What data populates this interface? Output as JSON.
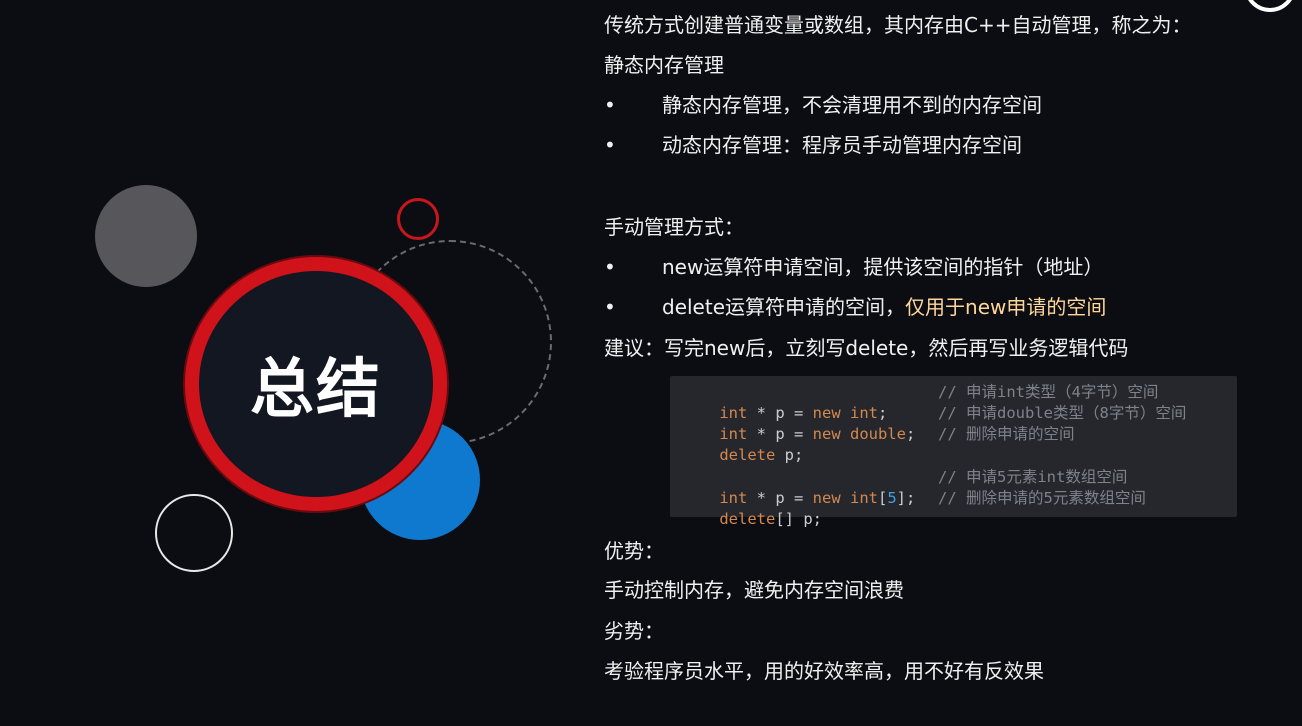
{
  "title": "总结",
  "intro": {
    "line1": "传统方式创建普通变量或数组，其内存由C++自动管理，称之为：",
    "line2": "静态内存管理"
  },
  "memory_types": [
    "静态内存管理，不会清理用不到的内存空间",
    "动态内存管理：程序员手动管理内存空间"
  ],
  "manual": {
    "heading": "手动管理方式：",
    "bullet1": "new运算符申请空间，提供该空间的指针（地址）",
    "bullet2_normal": "delete运算符申请的空间，",
    "bullet2_highlight": "仅用于new申请的空间"
  },
  "advice": "建议：写完new后，立刻写delete，然后再写业务逻辑代码",
  "code": {
    "line1_kw1": "int",
    "line1_rest1": " * p = ",
    "line1_kw2": "new int",
    "line1_rest2": ";",
    "line1_comment": "// 申请int类型（4字节）空间",
    "line2_kw1": "int",
    "line2_rest1": " * p = ",
    "line2_kw2": "new double",
    "line2_rest2": ";",
    "line2_comment": "// 申请double类型（8字节）空间",
    "line3_kw1": "delete",
    "line3_rest1": " p;",
    "line3_comment": "// 删除申请的空间",
    "line4_kw1": "int",
    "line4_rest1": " * p = ",
    "line4_kw2": "new int",
    "line4_rest2": "[",
    "line4_num": "5",
    "line4_rest3": "];",
    "line4_comment": "// 申请5元素int数组空间",
    "line5_kw1": "delete",
    "line5_rest1": "[] p;",
    "line5_comment": "// 删除申请的5元素数组空间"
  },
  "pros": {
    "heading": "优势：",
    "text": "手动控制内存，避免内存空间浪费"
  },
  "cons": {
    "heading": "劣势：",
    "text": "考验程序员水平，用的好效率高，用不好有反效果"
  },
  "bullet_symbol": "•",
  "colors": {
    "background": "#0c0d12",
    "ring_red": "#d0131b",
    "blue_circle": "#0f79cf",
    "gray_circle": "#57575b",
    "highlight_text": "#ffd79a",
    "code_keyword": "#d4884e",
    "code_number": "#3fa0e8",
    "code_comment": "#7e828a"
  }
}
